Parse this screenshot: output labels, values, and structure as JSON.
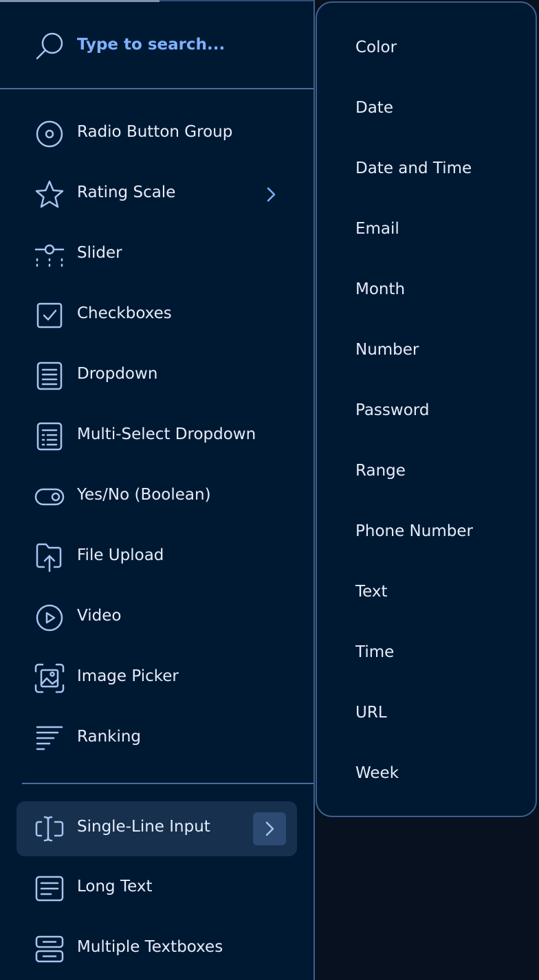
{
  "search": {
    "placeholder": "Type to search..."
  },
  "menu": {
    "items": [
      {
        "label": "Radio Button Group",
        "icon": "radio-icon"
      },
      {
        "label": "Rating Scale",
        "icon": "star-icon",
        "has_submenu": true
      },
      {
        "label": "Slider",
        "icon": "slider-icon"
      },
      {
        "label": "Checkboxes",
        "icon": "checkbox-icon"
      },
      {
        "label": "Dropdown",
        "icon": "dropdown-icon"
      },
      {
        "label": "Multi-Select Dropdown",
        "icon": "multi-select-icon"
      },
      {
        "label": "Yes/No (Boolean)",
        "icon": "toggle-icon"
      },
      {
        "label": "File Upload",
        "icon": "file-upload-icon"
      },
      {
        "label": "Video",
        "icon": "play-icon"
      },
      {
        "label": "Image Picker",
        "icon": "image-icon"
      },
      {
        "label": "Ranking",
        "icon": "ranking-icon"
      }
    ],
    "bottom_items": [
      {
        "label": "Single-Line Input",
        "icon": "text-cursor-icon",
        "active": true,
        "has_submenu": true
      },
      {
        "label": "Long Text",
        "icon": "long-text-icon"
      },
      {
        "label": "Multiple Textboxes",
        "icon": "multiple-textboxes-icon"
      }
    ]
  },
  "submenu": {
    "items": [
      "Color",
      "Date",
      "Date and Time",
      "Email",
      "Month",
      "Number",
      "Password",
      "Range",
      "Phone Number",
      "Text",
      "Time",
      "URL",
      "Week"
    ]
  },
  "colors": {
    "background": "#001933",
    "accent": "#7fb1ff",
    "text": "#e6edf8",
    "icon": "#a9c4ef",
    "border": "#3e5f8e",
    "active_bg": "#16304e"
  }
}
